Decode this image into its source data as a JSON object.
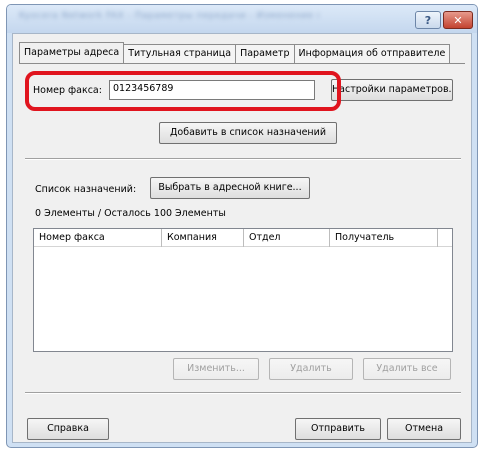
{
  "window": {
    "title_blurred": "Kyocera Network FAX - Параметры передачи - Изменение параметров",
    "help_glyph": "?",
    "close_glyph": "✕"
  },
  "tabs": [
    {
      "label": "Параметры адреса",
      "active": true
    },
    {
      "label": "Титульная страница",
      "active": false
    },
    {
      "label": "Параметр",
      "active": false
    },
    {
      "label": "Информация об отправителе",
      "active": false
    }
  ],
  "fax": {
    "label": "Номер факса:",
    "value": "0123456789",
    "settings_button": "Настройки параметров..."
  },
  "add_button": "Добавить в список назначений",
  "destinations": {
    "label": "Список назначений:",
    "address_book_button": "Выбрать в адресной книге...",
    "count_text": "0 Элементы / Осталось 100 Элементы",
    "columns": [
      "Номер факса",
      "Компания",
      "Отдел",
      "Получатель"
    ],
    "rows": []
  },
  "list_actions": {
    "edit": "Изменить...",
    "delete": "Удалить",
    "delete_all": "Удалить все"
  },
  "footer": {
    "help": "Справка",
    "send": "Отправить",
    "cancel": "Отмена"
  },
  "colors": {
    "highlight": "#e0141e",
    "titlebar": "#c4d7ee",
    "close": "#c3432f"
  }
}
